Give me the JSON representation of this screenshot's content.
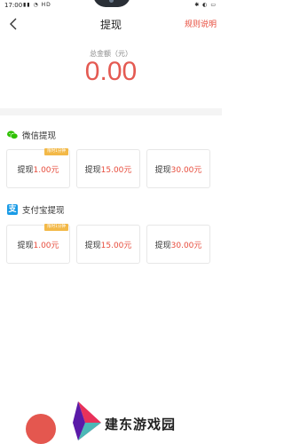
{
  "status": {
    "time": "17:00"
  },
  "header": {
    "title": "提现",
    "rules_label": "规则说明"
  },
  "balance": {
    "label": "总金额（元）",
    "amount": "0.00"
  },
  "wechat": {
    "title": "微信提现",
    "options": [
      {
        "prefix": "提现",
        "amount": "1.00元",
        "tag": "限时1分钟"
      },
      {
        "prefix": "提现",
        "amount": "15.00元",
        "tag": ""
      },
      {
        "prefix": "提现",
        "amount": "30.00元",
        "tag": ""
      }
    ]
  },
  "alipay": {
    "title": "支付宝提现",
    "icon_glyph": "支",
    "options": [
      {
        "prefix": "提现",
        "amount": "1.00元",
        "tag": "限时1分钟"
      },
      {
        "prefix": "提现",
        "amount": "15.00元",
        "tag": ""
      },
      {
        "prefix": "提现",
        "amount": "30.00元",
        "tag": ""
      }
    ]
  },
  "watermark": {
    "text": "建东游戏园"
  },
  "colors": {
    "accent": "#e74c3c",
    "amount": "#e45a52",
    "tag": "#f3b948",
    "wechat": "#2dc100",
    "alipay": "#1a9be6"
  }
}
